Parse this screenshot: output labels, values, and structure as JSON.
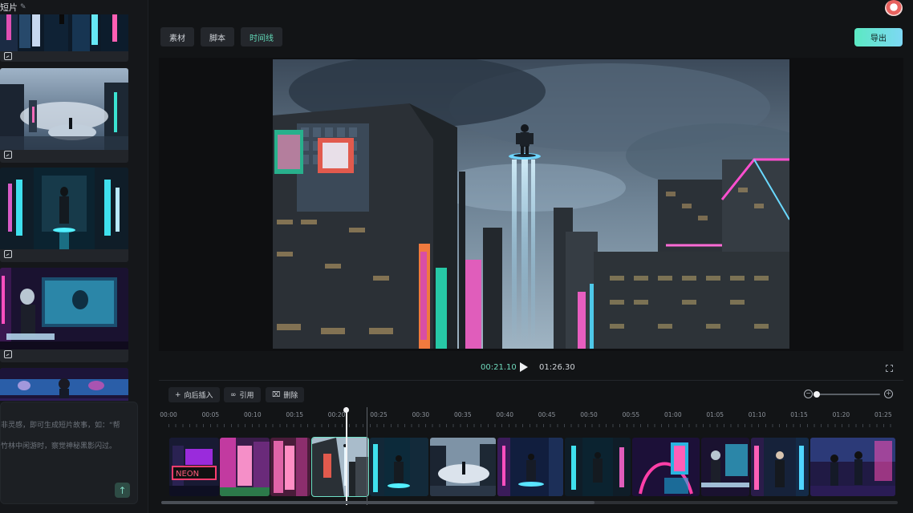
{
  "project": {
    "title": "短片",
    "edit_icon": "pencil-icon"
  },
  "user": {
    "avatar_icon": "avatar-icon"
  },
  "tabs": [
    {
      "label": "素材",
      "active": false
    },
    {
      "label": "脚本",
      "active": false
    },
    {
      "label": "时间线",
      "active": true
    }
  ],
  "export_label": "导出",
  "colors": {
    "accent": "#62d9b8",
    "export_from": "#5be9c2",
    "export_to": "#7ed8f4",
    "background": "#121416"
  },
  "shots": [
    {
      "badge_icon": "image-icon"
    },
    {
      "badge_icon": "image-icon"
    },
    {
      "badge_icon": "image-icon"
    },
    {
      "badge_icon": "image-icon"
    },
    {
      "badge_icon": "image-icon"
    }
  ],
  "prompt": {
    "text": "非灵感，即可生成短片故事，如：“帮\n竹林中闲游时，察觉神秘黑影闪过。",
    "send_icon": "arrow-up-icon"
  },
  "player": {
    "current_time": "00:21.10",
    "total_time": "01:26.30",
    "play_icon": "play-icon",
    "fullscreen_icon": "fullscreen-icon"
  },
  "timeline_toolbar": [
    {
      "label": "向后插入",
      "icon": "plus-icon"
    },
    {
      "label": "引用",
      "icon": "link-icon"
    },
    {
      "label": "删除",
      "icon": "trash-icon"
    }
  ],
  "zoom": {
    "out_icon": "zoom-out-icon",
    "in_icon": "zoom-in-icon",
    "level": 0
  },
  "ruler_labels": [
    "00:00",
    "00:05",
    "00:10",
    "00:15",
    "00:20",
    "00:25",
    "00:30",
    "00:35",
    "00:40",
    "00:45",
    "00:50",
    "00:55",
    "01:00",
    "01:05",
    "01:10",
    "01:15",
    "01:20",
    "01:25"
  ],
  "clip_sign_text": "NEON"
}
